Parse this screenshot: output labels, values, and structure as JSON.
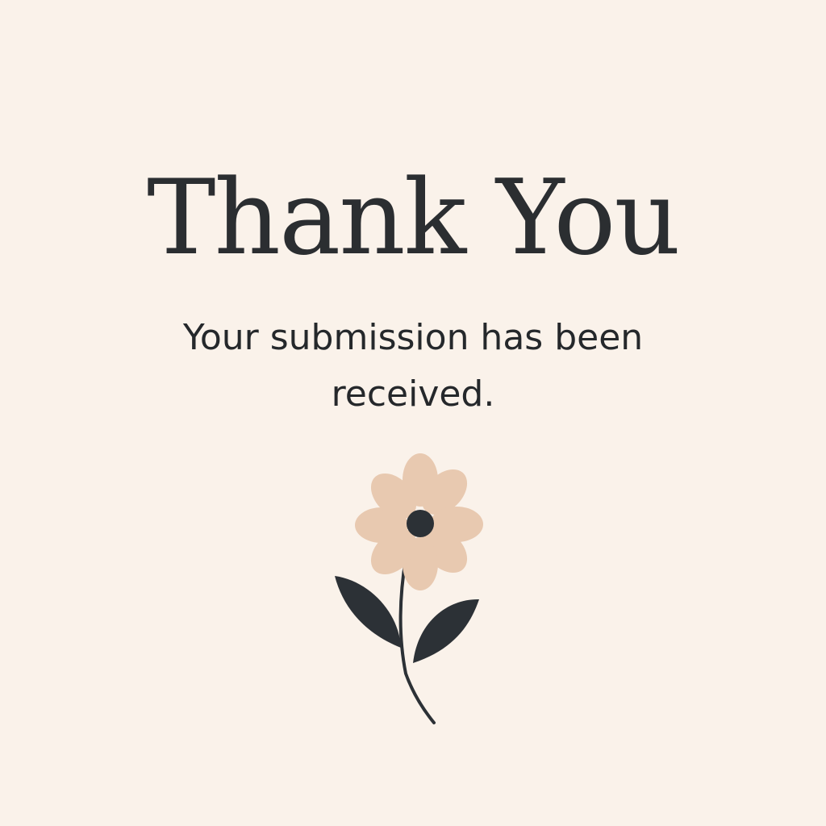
{
  "confirmation": {
    "title": "Thank You",
    "message": "Your submission has been received."
  },
  "illustration": {
    "icon": "flower-icon",
    "colors": {
      "background": "#faf2ea",
      "petal": "#e8c9b0",
      "center": "#2c3136",
      "leaf": "#2c3136",
      "stem": "#2c3136"
    }
  }
}
